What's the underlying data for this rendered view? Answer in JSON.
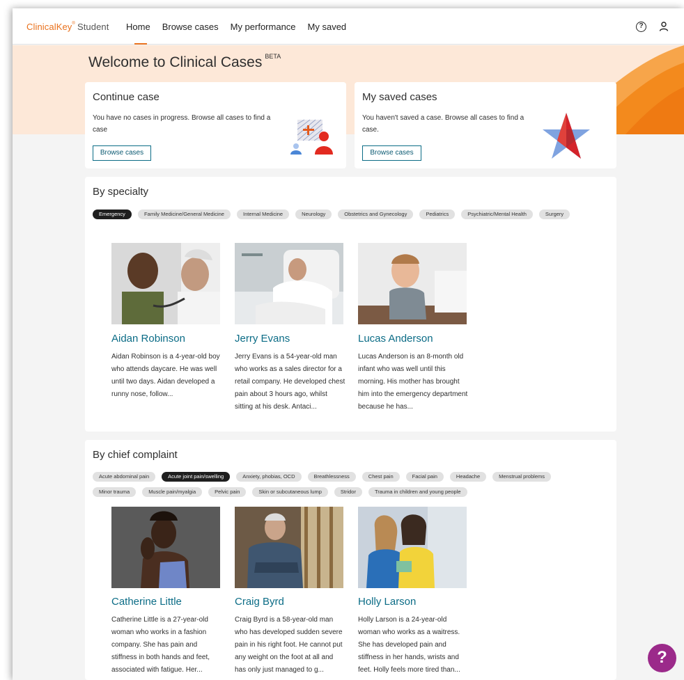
{
  "header": {
    "logo": "ClinicalKey",
    "logo_mark": "®",
    "logo_sub": "Student",
    "nav": [
      "Home",
      "Browse cases",
      "My performance",
      "My saved"
    ],
    "icons": [
      "help-icon",
      "user-icon"
    ]
  },
  "welcome": {
    "title": "Welcome to Clinical Cases",
    "badge": "BETA"
  },
  "continue_case": {
    "title": "Continue case",
    "text": "You have no cases in progress. Browse all cases to find a case",
    "button": "Browse cases"
  },
  "saved_cases": {
    "title": "My saved cases",
    "text": "You haven't saved a case. Browse all cases to find a case.",
    "button": "Browse cases"
  },
  "specialty": {
    "title": "By specialty",
    "chips": [
      "Emergency",
      "Family Medicine/General Medicine",
      "Internal Medicine",
      "Neurology",
      "Obstetrics and Gynecology",
      "Pediatrics",
      "Psychiatric/Mental Health",
      "Surgery"
    ],
    "active": "Emergency",
    "cases": [
      {
        "name": "Aidan Robinson",
        "desc": "Aidan Robinson is a 4-year-old boy who attends daycare. He was well until two days. Aidan developed a runny nose, follow..."
      },
      {
        "name": "Jerry Evans",
        "desc": "Jerry Evans is a 54-year-old man who works as a sales director for a retail company. He developed chest pain about 3 hours ago, whilst sitting at his desk. Antaci..."
      },
      {
        "name": "Lucas Anderson",
        "desc": "Lucas Anderson is an 8-month old infant who was well until this morning. His mother has brought him into the emergency department because he has..."
      }
    ]
  },
  "complaint": {
    "title": "By chief complaint",
    "chips": [
      "Acute abdominal pain",
      "Acute joint pain/swelling",
      "Anxiety, phobias, OCD",
      "Breathlessness",
      "Chest pain",
      "Facial pain",
      "Headache",
      "Menstrual problems",
      "Minor trauma",
      "Muscle pain/myalgia",
      "Pelvic pain",
      "Skin or subcutaneous lump",
      "Stridor",
      "Trauma in children and young people"
    ],
    "active": "Acute joint pain/swelling",
    "cases": [
      {
        "name": "Catherine Little",
        "desc": "Catherine Little is a 27-year-old woman who works in a fashion company. She has pain and stiffness in both hands and feet, associated with fatigue. Her..."
      },
      {
        "name": "Craig Byrd",
        "desc": "Craig Byrd is a 58-year-old man who has developed sudden severe pain in his right foot. He cannot put any weight on the foot at all and has only just managed to g..."
      },
      {
        "name": "Holly Larson",
        "desc": "Holly Larson is a 24-year-old woman who works as a waitress. She has developed pain and stiffness in her hands, wrists and feet. Holly feels more tired than..."
      }
    ]
  },
  "fab": {
    "label": "?"
  },
  "colors": {
    "brand": "#e9711c",
    "link": "#0b6c86",
    "chip_active": "#1f1f1f",
    "fab": "#9b2a8a"
  }
}
